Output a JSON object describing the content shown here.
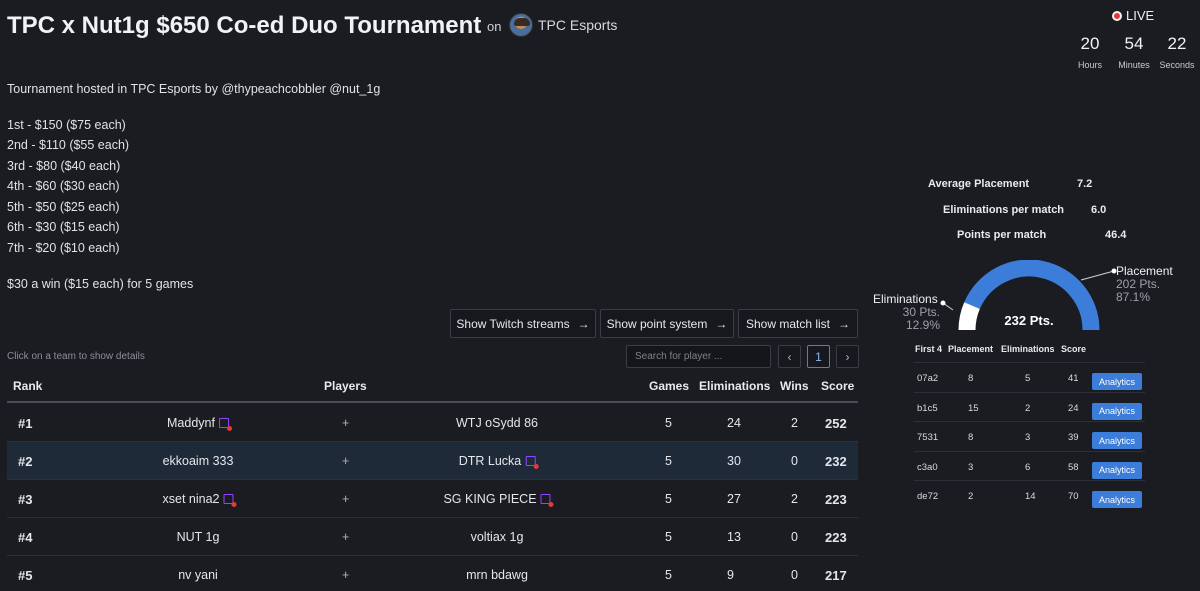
{
  "header": {
    "title": "TPC x Nut1g $650 Co-ed Duo Tournament",
    "on": "on",
    "org_name": "TPC Esports",
    "live_label": "LIVE",
    "countdown": [
      {
        "value": "20",
        "unit": "Hours"
      },
      {
        "value": "54",
        "unit": "Minutes"
      },
      {
        "value": "22",
        "unit": "Seconds"
      }
    ]
  },
  "description": {
    "hosted": "Tournament hosted in TPC Esports by @thypeachcobbler @nut_1g",
    "prizes": [
      "1st - $150 ($75 each)",
      "2nd - $110 ($55 each)",
      "3rd - $80 ($40 each)",
      "4th - $60 ($30 each)",
      "5th - $50 ($25 each)",
      "6th - $30 ($15 each)",
      "7th - $20 ($10 each)"
    ],
    "win_bonus": "$30 a win ($15 each) for 5 games"
  },
  "stats": [
    {
      "label": "Average Placement",
      "value": "7.2"
    },
    {
      "label": "Eliminations per match",
      "value": "6.0"
    },
    {
      "label": "Points per match",
      "value": "46.4"
    }
  ],
  "gauge": {
    "center": "232 Pts.",
    "eliminations": {
      "label": "Eliminations",
      "pts": "30 Pts.",
      "pct": "12.9%",
      "fraction": 0.129,
      "color": "#ffffff"
    },
    "placement": {
      "label": "Placement",
      "pts": "202 Pts.",
      "pct": "87.1%",
      "fraction": 0.871,
      "color": "#3c7dd9"
    }
  },
  "buttons": {
    "twitch": "Show Twitch streams",
    "points": "Show point system",
    "matches": "Show match list",
    "arrow": "→"
  },
  "table_hint": "Click on a team to show details",
  "search": {
    "placeholder": "Search for player ..."
  },
  "pagination": {
    "prev": "‹",
    "page": "1",
    "next": "›"
  },
  "leaderboard": {
    "columns": {
      "rank": "Rank",
      "players": "Players",
      "games": "Games",
      "eliminations": "Eliminations",
      "wins": "Wins",
      "score": "Score"
    },
    "rows": [
      {
        "rank": "#1",
        "p1": "Maddynf",
        "p1_tw": true,
        "sep": "+",
        "p2": "WTJ oSydd 86",
        "p2_tw": false,
        "games": "5",
        "elims": "24",
        "wins": "2",
        "score": "252"
      },
      {
        "rank": "#2",
        "p1": "ekkoaim 333",
        "p1_tw": false,
        "sep": "+",
        "p2": "DTR Lucka",
        "p2_tw": true,
        "games": "5",
        "elims": "30",
        "wins": "0",
        "score": "232"
      },
      {
        "rank": "#3",
        "p1": "xset nina2",
        "p1_tw": true,
        "sep": "+",
        "p2": "SG KING PIECE",
        "p2_tw": true,
        "games": "5",
        "elims": "27",
        "wins": "2",
        "score": "223"
      },
      {
        "rank": "#4",
        "p1": "NUT 1g",
        "p1_tw": false,
        "sep": "+",
        "p2": "voltiax 1g",
        "p2_tw": false,
        "games": "5",
        "elims": "13",
        "wins": "0",
        "score": "223"
      },
      {
        "rank": "#5",
        "p1": "nv yani",
        "p1_tw": false,
        "sep": "+",
        "p2": "mrn bdawg",
        "p2_tw": false,
        "games": "5",
        "elims": "9",
        "wins": "0",
        "score": "217"
      }
    ]
  },
  "matches": {
    "columns": {
      "id": "First 4",
      "placement": "Placement",
      "eliminations": "Eliminations",
      "score": "Score"
    },
    "button_label": "Analytics",
    "rows": [
      {
        "id": "07a2",
        "placement": "8",
        "eliminations": "5",
        "score": "41"
      },
      {
        "id": "b1c5",
        "placement": "15",
        "eliminations": "2",
        "score": "24"
      },
      {
        "id": "7531",
        "placement": "8",
        "eliminations": "3",
        "score": "39"
      },
      {
        "id": "c3a0",
        "placement": "3",
        "eliminations": "6",
        "score": "58"
      },
      {
        "id": "de72",
        "placement": "2",
        "eliminations": "14",
        "score": "70"
      }
    ]
  }
}
